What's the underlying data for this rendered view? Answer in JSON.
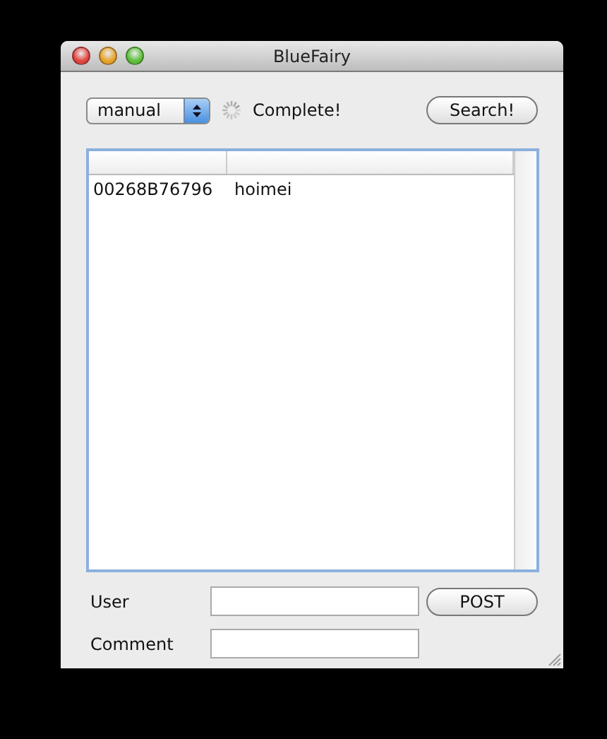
{
  "window": {
    "title": "BlueFairy"
  },
  "mode_popup": {
    "value": "manual"
  },
  "status": "Complete!",
  "search_button": "Search!",
  "table": {
    "rows": [
      {
        "column_1": "00268B76796",
        "column_2": "hoimei"
      }
    ]
  },
  "form": {
    "fields": [
      {
        "label": "User"
      },
      {
        "label": "Comment"
      }
    ],
    "post_button": "POST"
  }
}
